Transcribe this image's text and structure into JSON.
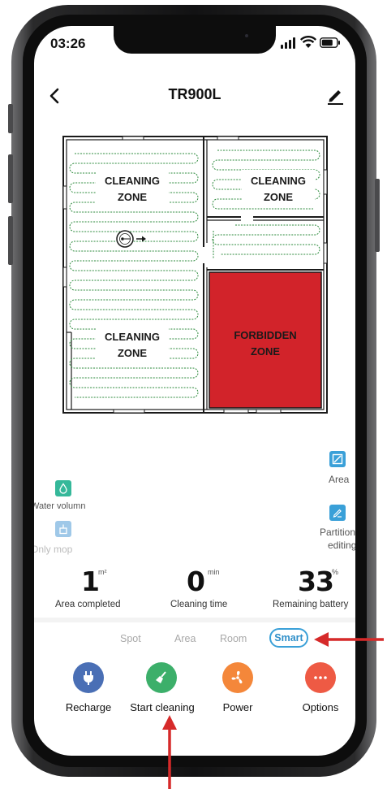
{
  "status_bar": {
    "time": "03:26"
  },
  "header": {
    "title": "TR900L"
  },
  "map": {
    "zones": {
      "top_left": [
        "CLEANING",
        "ZONE"
      ],
      "top_right": [
        "CLEANING",
        "ZONE"
      ],
      "bottom_left": [
        "CLEANING",
        "ZONE"
      ],
      "forbidden": [
        "FORBIDDEN",
        "ZONE"
      ]
    },
    "colors": {
      "forbidden": "#d2232a",
      "path": "#2e8b3e",
      "walls": "#1a1a1a"
    }
  },
  "controls": {
    "area_label": "Area",
    "partition_label_1": "Partition",
    "partition_label_2": "editing",
    "water_label": "Water volumn",
    "mop_label": "Only mop"
  },
  "stats": {
    "area": {
      "value": "1",
      "unit": "m²",
      "label": "Area completed"
    },
    "time": {
      "value": "0",
      "unit": "min",
      "label": "Cleaning time"
    },
    "battery": {
      "value": "33",
      "unit": "%",
      "label": "Remaining battery"
    }
  },
  "modes": {
    "spot": "Spot",
    "area": "Area",
    "room": "Room",
    "smart": "Smart",
    "selected": "Smart"
  },
  "actions": {
    "recharge": {
      "label": "Recharge",
      "color": "#4a6fb5"
    },
    "start": {
      "label": "Start cleaning",
      "color": "#3caf6a"
    },
    "power": {
      "label": "Power",
      "color": "#f4873a"
    },
    "options": {
      "label": "Options",
      "color": "#ee5a44"
    }
  },
  "accent_color": "#3aa0d8",
  "annotation_color": "#d62a2a"
}
